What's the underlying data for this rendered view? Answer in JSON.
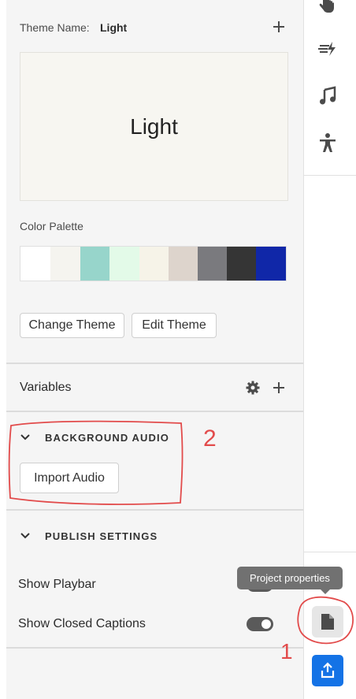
{
  "theme": {
    "name_label": "Theme Name:",
    "name_value": "Light",
    "preview_text": "Light"
  },
  "palette": {
    "label": "Color Palette",
    "swatches": [
      "#ffffff",
      "#f5f4ef",
      "#97d5cb",
      "#e3fae8",
      "#f6f3e8",
      "#ddd4cc",
      "#7a7a7e",
      "#353535",
      "#1027a8"
    ]
  },
  "buttons": {
    "change_theme": "Change Theme",
    "edit_theme": "Edit Theme",
    "import_audio": "Import Audio"
  },
  "variables": {
    "label": "Variables"
  },
  "sections": {
    "background_audio": "BACKGROUND AUDIO",
    "publish_settings": "PUBLISH SETTINGS"
  },
  "publish": {
    "show_playbar": {
      "label": "Show Playbar",
      "enabled": true
    },
    "show_closed_captions": {
      "label": "Show Closed Captions",
      "enabled": true
    }
  },
  "tooltip": {
    "text": "Project properties"
  },
  "annotations": {
    "red_number_2": "2",
    "red_number_1": "1"
  },
  "rail_icons": [
    "hand-icon",
    "transition-icon",
    "music-note-icon",
    "accessibility-icon",
    "document-icon",
    "share-icon"
  ],
  "colors": {
    "accent": "#1473e6",
    "annotation": "#e24b4b"
  }
}
